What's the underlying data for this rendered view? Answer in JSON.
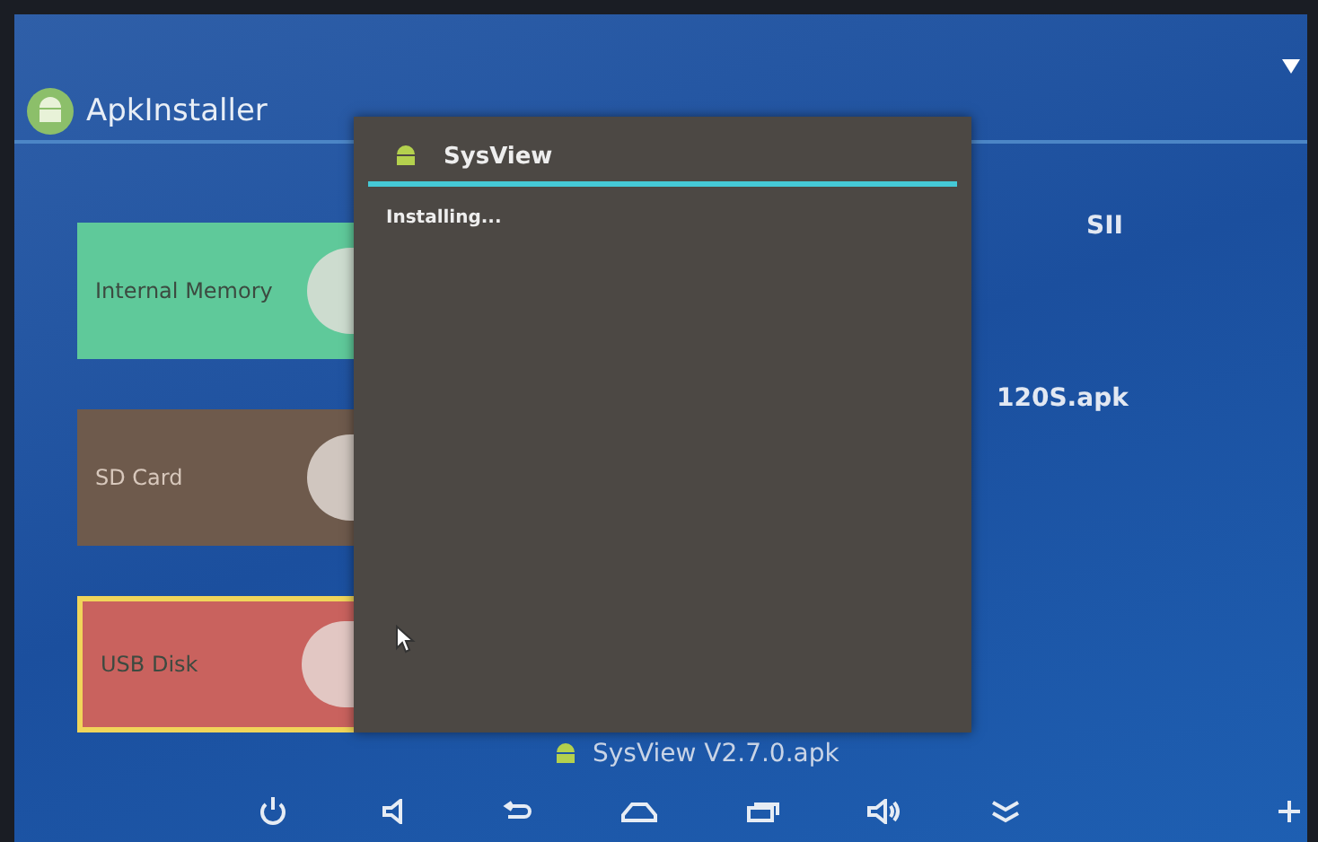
{
  "app": {
    "title": "ApkInstaller"
  },
  "storage": [
    {
      "label": "Internal Memory",
      "color": "#5fc99a",
      "selected": false
    },
    {
      "label": "SD Card",
      "color": "#6e5a4c",
      "selected": false
    },
    {
      "label": "USB Disk",
      "color": "#c9625e",
      "selected": true
    }
  ],
  "files": [
    {
      "name": "SII"
    },
    {
      "name": "120S.apk"
    }
  ],
  "bottom_file": {
    "name": "SysView V2.7.0.apk"
  },
  "dialog": {
    "title": "SysView",
    "message": "Installing..."
  },
  "nav": [
    {
      "kind": "power"
    },
    {
      "kind": "volume-down"
    },
    {
      "kind": "back"
    },
    {
      "kind": "home"
    },
    {
      "kind": "recent"
    },
    {
      "kind": "volume-up"
    },
    {
      "kind": "collapse"
    },
    {
      "kind": "plus"
    }
  ]
}
